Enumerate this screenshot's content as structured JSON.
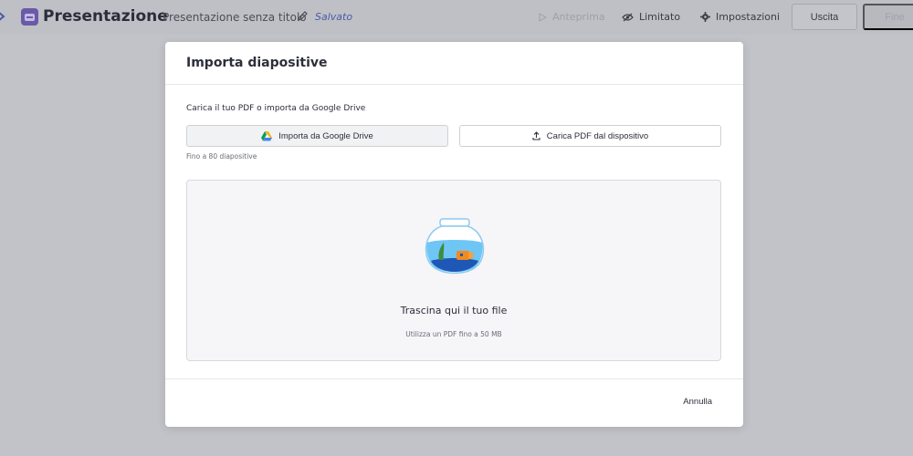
{
  "app": {
    "name": "Presentazione",
    "doc_title": "Presentazione senza titolo",
    "status": "Salvato",
    "brand_color": "#6b5aa8"
  },
  "topbar": {
    "preview_label": "Anteprima",
    "visibility_label": "Limitato",
    "settings_label": "Impostazioni",
    "exit_label": "Uscita",
    "done_label": "Fine"
  },
  "modal": {
    "title": "Importa diapositive",
    "intro": "Carica il tuo PDF o importa da Google Drive",
    "gdrive_button": "Importa da Google Drive",
    "upload_button": "Carica PDF dal dispositivo",
    "limit_note": "Fino a 80 diapositive",
    "dropzone_title": "Trascina qui il tuo file",
    "dropzone_subtitle": "Utilizza un PDF fino a 50 MB",
    "cancel_button": "Annulla"
  }
}
